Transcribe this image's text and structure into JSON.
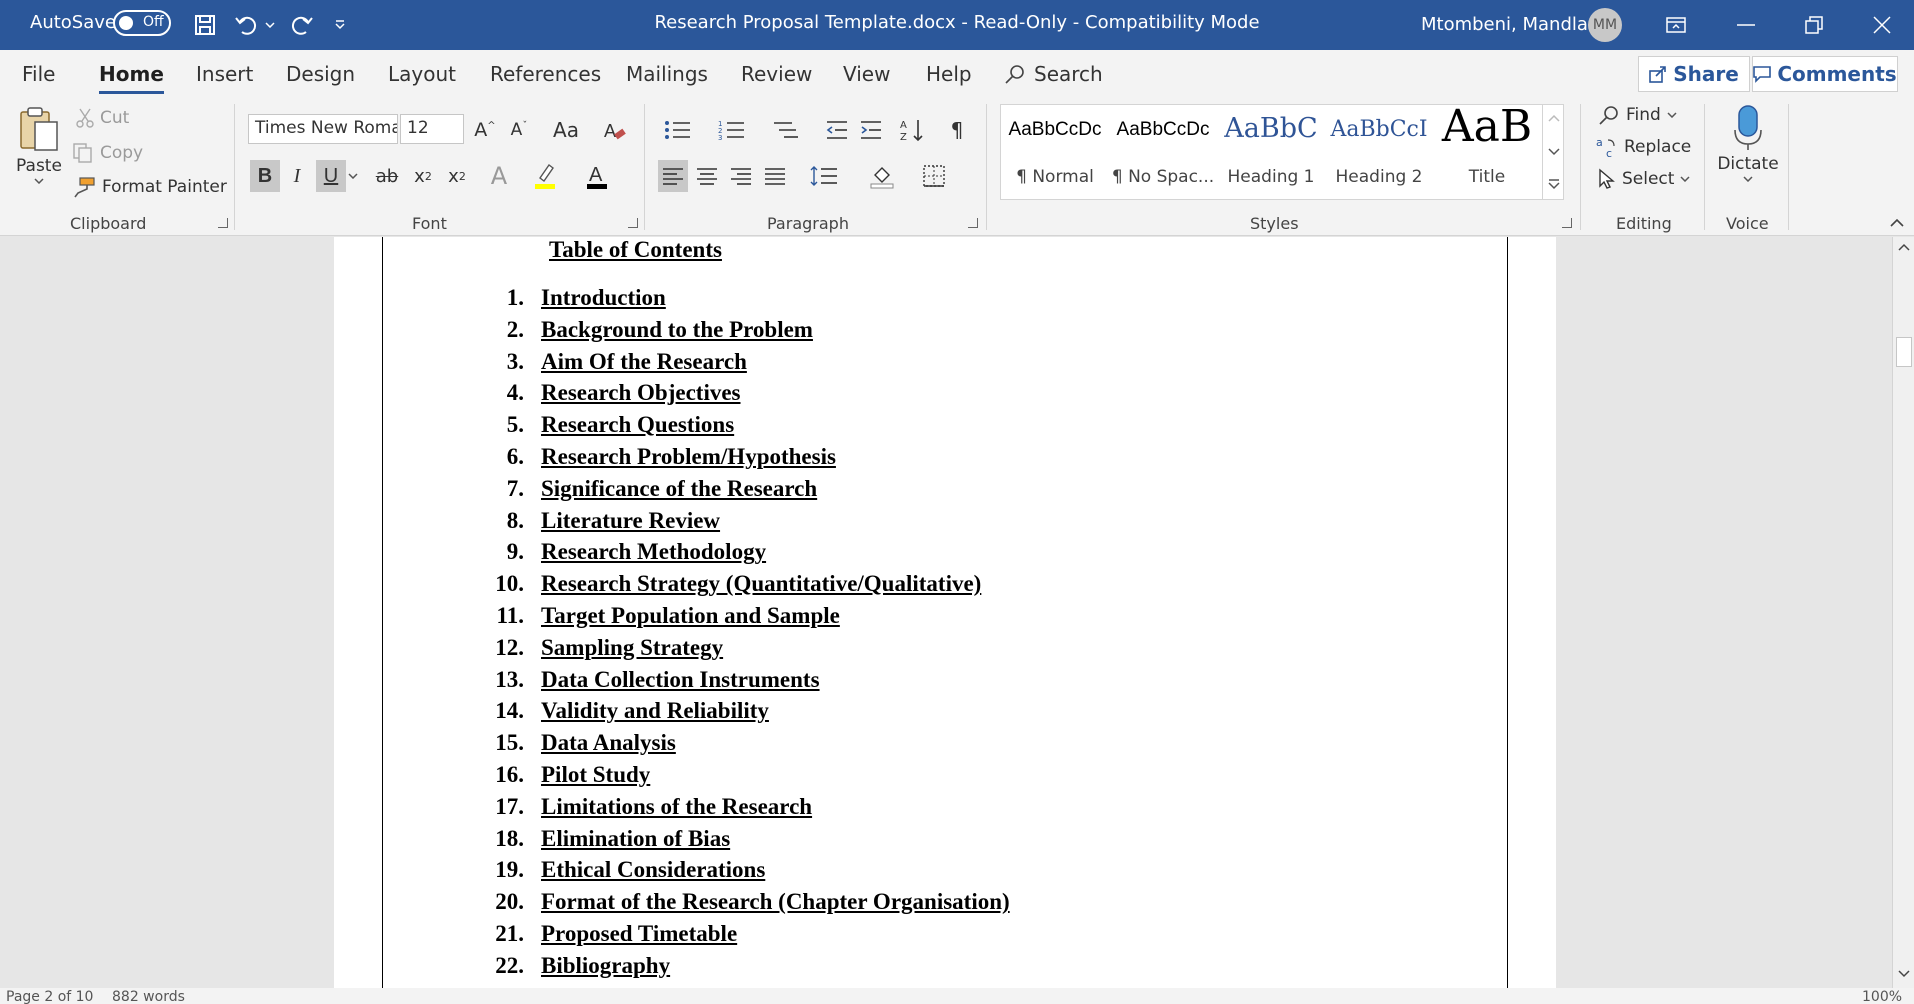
{
  "titlebar": {
    "autosave_label": "AutoSave",
    "autosave_state": "Off",
    "document_title": "Research Proposal Template.docx  -  Read-Only  -  Compatibility Mode",
    "user_name": "Mtombeni, Mandla",
    "user_initials": "MM",
    "bg_color": "#2b579a"
  },
  "tabs": [
    "File",
    "Home",
    "Insert",
    "Design",
    "Layout",
    "References",
    "Mailings",
    "Review",
    "View",
    "Help"
  ],
  "active_tab": "Home",
  "search_label": "Search",
  "share_label": "Share",
  "comments_label": "Comments",
  "clipboard": {
    "paste": "Paste",
    "cut": "Cut",
    "copy": "Copy",
    "format_painter": "Format Painter",
    "group_label": "Clipboard"
  },
  "font": {
    "family": "Times New Roma",
    "size": "12",
    "group_label": "Font",
    "change_case": "Aa"
  },
  "paragraph": {
    "group_label": "Paragraph"
  },
  "styles": {
    "group_label": "Styles",
    "items": [
      {
        "sample": "AaBbCcDc",
        "name": "¶ Normal"
      },
      {
        "sample": "AaBbCcDc",
        "name": "¶ No Spac..."
      },
      {
        "sample": "AaBbC",
        "name": "Heading 1"
      },
      {
        "sample": "AaBbCcI",
        "name": "Heading 2"
      },
      {
        "sample": "AaB",
        "name": "Title"
      }
    ]
  },
  "editing": {
    "find": "Find",
    "replace": "Replace",
    "select": "Select",
    "group_label": "Editing"
  },
  "voice": {
    "dictate": "Dictate",
    "group_label": "Voice"
  },
  "document": {
    "toc_title": "Table of Contents",
    "toc_items": [
      {
        "num": "1.",
        "text": "Introduction"
      },
      {
        "num": "2.",
        "text": "Background to the Problem"
      },
      {
        "num": "3.",
        "text": "Aim Of the Research"
      },
      {
        "num": "4.",
        "text": "Research Objectives"
      },
      {
        "num": "5.",
        "text": "Research Questions"
      },
      {
        "num": "6.",
        "text": "Research Problem/Hypothesis"
      },
      {
        "num": "7.",
        "text": "Significance of the Research"
      },
      {
        "num": "8.",
        "text": "Literature Review"
      },
      {
        "num": "9.",
        "text": "Research Methodology"
      },
      {
        "num": "10.",
        "text": "Research Strategy (Quantitative/Qualitative)"
      },
      {
        "num": "11.",
        "text": "Target Population and Sample"
      },
      {
        "num": "12.",
        "text": "Sampling Strategy"
      },
      {
        "num": "13.",
        "text": "Data Collection Instruments"
      },
      {
        "num": "14.",
        "text": "Validity and Reliability"
      },
      {
        "num": "15.",
        "text": "Data Analysis"
      },
      {
        "num": "16.",
        "text": "Pilot Study"
      },
      {
        "num": "17.",
        "text": "Limitations of the Research"
      },
      {
        "num": "18.",
        "text": "Elimination of Bias"
      },
      {
        "num": "19.",
        "text": "Ethical Considerations"
      },
      {
        "num": "20.",
        "text": "Format of the Research (Chapter Organisation)"
      },
      {
        "num": "21.",
        "text": "Proposed Timetable"
      },
      {
        "num": "22.",
        "text": "Bibliography"
      }
    ]
  },
  "statusbar": {
    "page": "Page 2 of 10",
    "words": "882 words",
    "zoom": "100%"
  }
}
